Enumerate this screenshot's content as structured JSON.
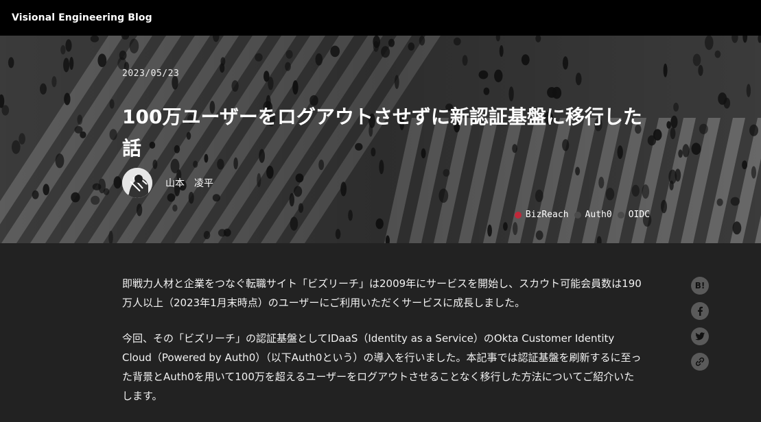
{
  "site": {
    "title": "Visional Engineering Blog"
  },
  "post": {
    "date": "2023/05/23",
    "title": "100万ユーザーをログアウトさせずに新認証基盤に移行した話",
    "author": "山本　凌平",
    "tags": [
      {
        "label": "BizReach",
        "color": "#c0283a"
      },
      {
        "label": "Auth0",
        "color": "#4a4a4a"
      },
      {
        "label": "OIDC",
        "color": "#4a4a4a"
      }
    ],
    "paragraphs": [
      "即戦力人材と企業をつなぐ転職サイト「ビズリーチ」は2009年にサービスを開始し、スカウト可能会員数は190万人以上（2023年1月末時点）のユーザーにご利用いただくサービスに成長しました。",
      "今回、その「ビズリーチ」の認証基盤としてIDaaS（Identity as a Service）のOkta Customer Identity Cloud（Powered by Auth0）（以下Auth0という）の導入を行いました。本記事では認証基盤を刷新するに至った背景とAuth0を用いて100万を超えるユーザーをログアウトさせることなく移行した方法についてご紹介いたします。"
    ]
  },
  "share": {
    "hatena_label": "B!",
    "icons": [
      "hatena-bookmark-icon",
      "facebook-icon",
      "twitter-icon",
      "link-icon"
    ]
  }
}
